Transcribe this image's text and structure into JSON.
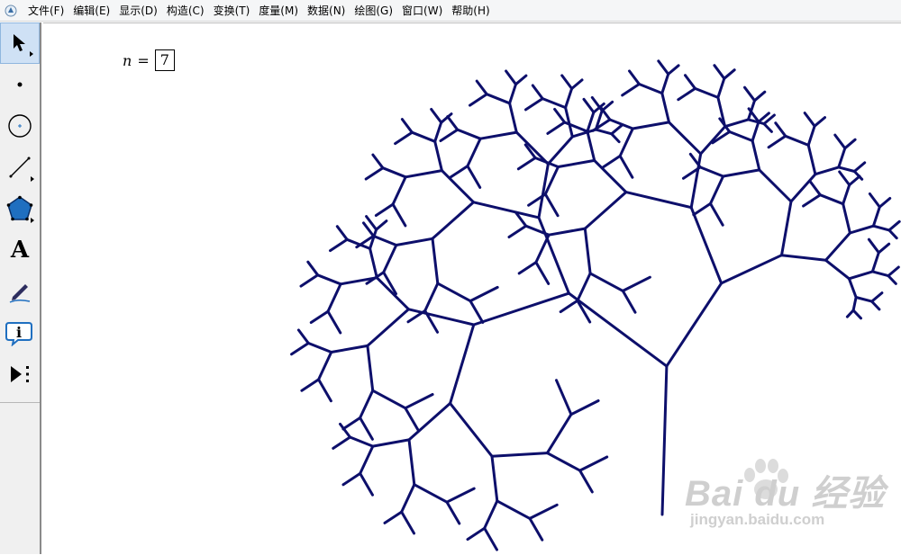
{
  "menubar": {
    "app_icon": "sketchpad-app-icon",
    "items": [
      "文件(F)",
      "编辑(E)",
      "显示(D)",
      "构造(C)",
      "变换(T)",
      "度量(M)",
      "数据(N)",
      "绘图(G)",
      "窗口(W)",
      "帮助(H)"
    ]
  },
  "toolbar": {
    "tools": [
      {
        "name": "arrow-select-tool",
        "icon": "arrow-icon",
        "active": true
      },
      {
        "name": "point-tool",
        "icon": "point-icon",
        "active": false
      },
      {
        "name": "compass-tool",
        "icon": "circle-icon",
        "active": false
      },
      {
        "name": "straightedge-tool",
        "icon": "line-icon",
        "active": false
      },
      {
        "name": "polygon-tool",
        "icon": "pentagon-icon",
        "active": false
      },
      {
        "name": "text-tool",
        "icon": "letter-a-icon",
        "active": false
      },
      {
        "name": "marker-tool",
        "icon": "pen-icon",
        "active": false
      },
      {
        "name": "information-tool",
        "icon": "info-icon",
        "active": false
      },
      {
        "name": "custom-tool",
        "icon": "play-more-icon",
        "active": false
      }
    ],
    "text_tool_glyph": "A",
    "info_tool_glyph": "i"
  },
  "parameter": {
    "variable": "n",
    "equals": "=",
    "value": "7"
  },
  "colors": {
    "tree_stroke": "#0d0f6b",
    "accent_selected": "#cfe1f5",
    "polygon_fill": "#1f6fc0"
  },
  "watermark": {
    "brand": "Bai du 经验",
    "sub": "jingyan.baidu.com"
  }
}
